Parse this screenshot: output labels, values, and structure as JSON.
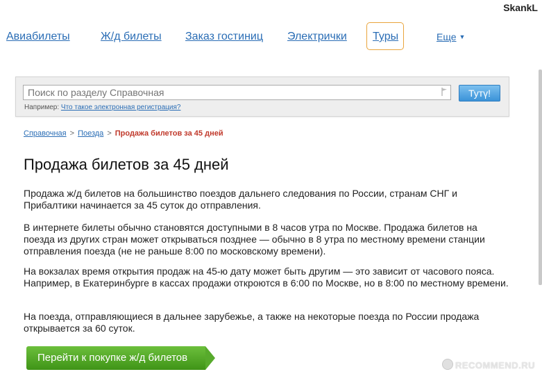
{
  "user": {
    "name": "SkankL"
  },
  "nav": {
    "items": [
      {
        "label": "Авиабилеты"
      },
      {
        "label": "Ж/д билеты"
      },
      {
        "label": "Заказ гостиниц"
      },
      {
        "label": "Электрички"
      }
    ],
    "active_item": {
      "label": "Туры"
    },
    "more_label": "Еще"
  },
  "search": {
    "placeholder": "Поиск по разделу Справочная",
    "button_label": "Тутү!",
    "example_prefix": "Например:",
    "example_link": "Что такое электронная регистрация?"
  },
  "breadcrumb": {
    "items": [
      "Справочная",
      "Поезда"
    ],
    "separator": ">",
    "current": "Продажа билетов за 45 дней"
  },
  "page": {
    "title": "Продажа билетов за 45 дней",
    "paragraphs": [
      "Продажа ж/д билетов на большинство поездов дальнего следования по России, странам СНГ и Прибалтики начинается за 45 суток до отправления.",
      "В интернете билеты обычно становятся доступными в 8 часов утра по Москве. Продажа билетов на поезда из других стран может открываться позднее — обычно в 8 утра по местному времени станции отправления поезда (не не раньше 8:00 по московскому времени).",
      "На вокзалах время открытия продаж на 45-ю дату может быть другим — это зависит от часового пояса. Например, в Екатеринбурге в кассах продажи откроются в 6:00 по Москве, но в 8:00 по местному времени.",
      "На поезда, отправляющиеся в дальнее зарубежье, а также на некоторые поезда по России продажа открывается за 60 суток."
    ],
    "cta_label": "Перейти к покупке ж/д билетов"
  },
  "watermark": {
    "text": "RECOMMEND.RU"
  },
  "colors": {
    "link": "#2a6db5",
    "active_border": "#e9a43b",
    "breadcrumb_current": "#c0392b",
    "search_button": "#3b93d8",
    "cta_green": "#4fa322"
  }
}
